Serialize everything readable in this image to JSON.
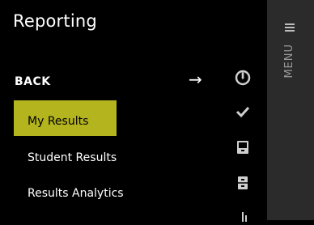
{
  "panel": {
    "title": "Reporting",
    "back_label": "BACK",
    "items": [
      {
        "label": "My Results",
        "selected": true
      },
      {
        "label": "Student Results",
        "selected": false
      },
      {
        "label": "Results Analytics",
        "selected": false
      }
    ],
    "highlight_color": "#b4b41f"
  },
  "rail": {
    "icons": [
      "power-icon",
      "check-icon",
      "drawer-icon",
      "cabinet-icon",
      "bar-chart-icon"
    ]
  },
  "menu": {
    "label": "MENU",
    "icon": "hamburger-icon"
  },
  "colors": {
    "background": "#000000",
    "menu_column": "#2b2b2b",
    "menu_text": "#9a9a9a"
  }
}
